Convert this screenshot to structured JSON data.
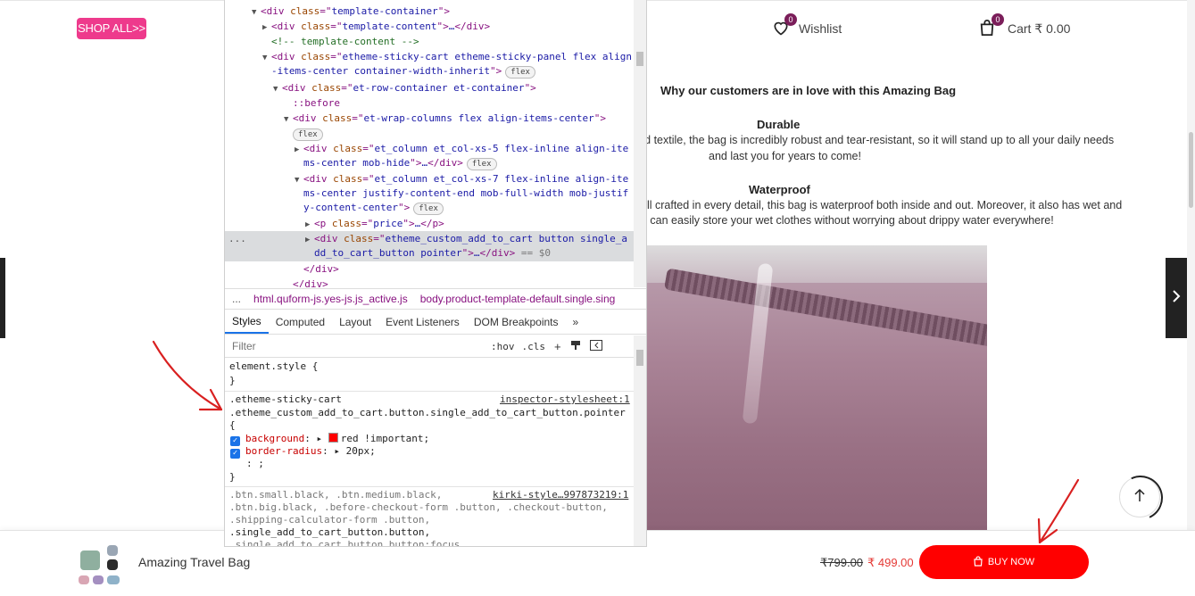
{
  "header": {
    "shop_all": "SHOP ALL>>",
    "wishlist_label": "Wishlist",
    "wishlist_count": "0",
    "cart_label": "Cart",
    "cart_amount": "₹ 0.00",
    "cart_count": "0"
  },
  "content": {
    "title": "Why our customers are in love with this Amazing Bag",
    "durable_title": "Durable",
    "durable_line1": "rd textile, the bag is incredibly robust and tear-resistant, so it will stand up to all your daily needs",
    "durable_line2": "and last you for years to come!",
    "waterproof_title": "Waterproof",
    "waterproof_line1": "ell crafted in every detail, this bag is waterproof both inside and out. Moreover, it also has wet and",
    "waterproof_line2": "u can easily store your wet clothes without worrying about drippy water everywhere!"
  },
  "sticky_cart": {
    "product_name": "Amazing Travel Bag",
    "price_old": "₹799.00",
    "price_new": "₹ 499.00",
    "buy_now": "BUY NOW"
  },
  "devtools": {
    "dom": {
      "l1_tag": "div",
      "l1_attr": "class",
      "l1_val": "template-container",
      "l2_val": "template-content",
      "l3_comment": "<!-- template-content -->",
      "l4_val": "etheme-sticky-cart etheme-sticky-panel flex align",
      "l4b_val": "-items-center container-width-inherit",
      "l5_val": "et-row-container et-container",
      "l6_pseudo": "::before",
      "l7_val": "et-wrap-columns flex align-items-center",
      "l8_val": "et_column et_col-xs-5 flex-inline align-ite",
      "l8b_val": "ms-center mob-hide",
      "l9_val": "et_column et_col-xs-7 flex-inline align-ite",
      "l9b_val": "ms-center justify-content-end mob-full-width mob-justif",
      "l9c_val": "y-content-center",
      "l10_val": "price",
      "l11_val": "etheme_custom_add_to_cart button single_a",
      "l11b_val": "dd_to_cart_button pointer",
      "eq0": "== $0",
      "flex": "flex",
      "ellipsis": "…",
      "dots": "..."
    },
    "breadcrumb": {
      "dots": "...",
      "html": "html.quform-js.yes-js.js_active.js",
      "body": "body.product-template-default.single.sing"
    },
    "tabs": [
      "Styles",
      "Computed",
      "Layout",
      "Event Listeners",
      "DOM Breakpoints"
    ],
    "tabs_more": "»",
    "filter_placeholder": "Filter",
    "hov": ":hov",
    "cls": ".cls",
    "add": "+",
    "styles": {
      "element_style": "element.style {",
      "close": "}",
      "rule1_sel1": ".etheme-sticky-cart",
      "rule1_source": "inspector-stylesheet:1",
      "rule1_sel2": ".etheme_custom_add_to_cart.button.single_add_to_cart_button.pointer",
      "rule1_open": "{",
      "prop1": "background",
      "val1": "red !important;",
      "prop2": "border-radius",
      "val2": "20px;",
      "prop3": ": ;",
      "rule2_sel1": ".btn.small.black, .btn.medium.black,",
      "rule2_source": "kirki-style…997873219:1",
      "rule2_sel2": ".btn.big.black, .before-checkout-form .button, .checkout-button,",
      "rule2_sel3": ".shipping-calculator-form .button,",
      "rule2_sel4": ".single_add_to_cart_button.button,",
      "rule2_sel5": ".single_add_to_cart_button.button:focus"
    }
  },
  "colors": {
    "accent_pink": "#ee3a8c",
    "buy_red": "#ff0000",
    "price_red": "#e53935",
    "badge": "#7b1e5a"
  }
}
